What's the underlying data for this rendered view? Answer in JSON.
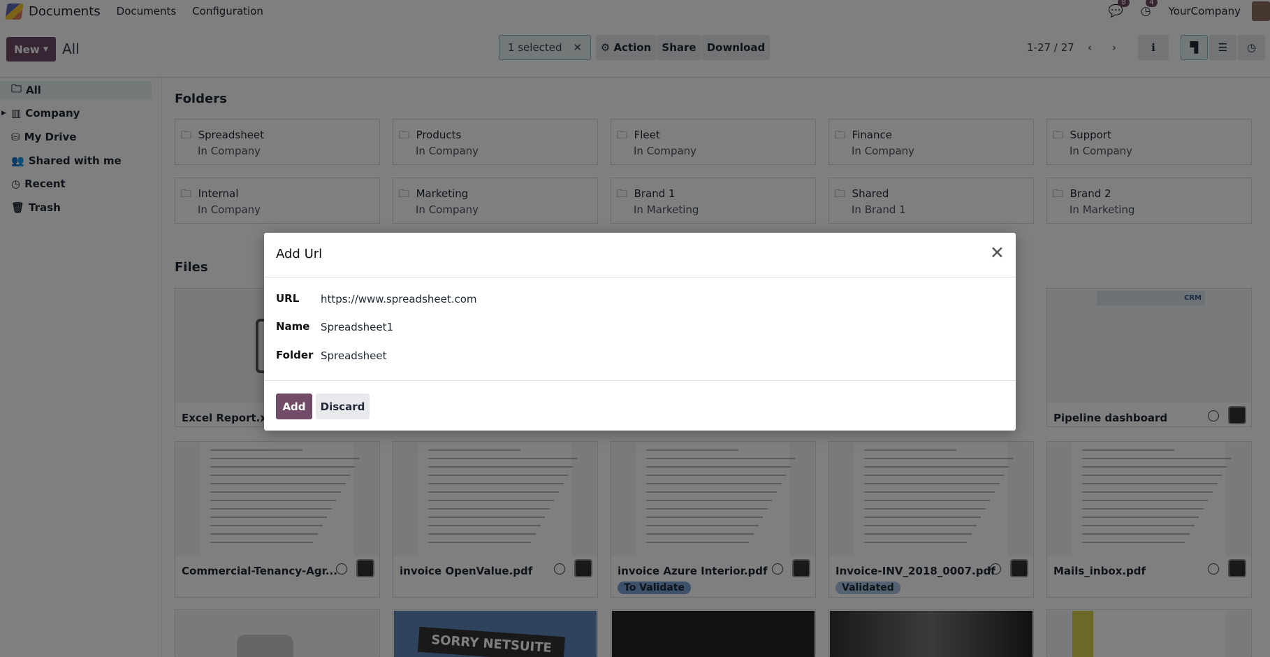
{
  "navbar": {
    "app": "Documents",
    "menus": [
      "Documents",
      "Configuration"
    ],
    "messages_count": "8",
    "activities_count": "4",
    "company": "YourCompany"
  },
  "control_panel": {
    "new_label": "New",
    "breadcrumb": "All",
    "selected": "1 selected",
    "action": "Action",
    "share": "Share",
    "download": "Download",
    "pager": "1-27 / 27"
  },
  "sidebar": {
    "items": [
      {
        "label": "All",
        "icon": "folder-icon"
      },
      {
        "label": "Company",
        "icon": "building-icon"
      },
      {
        "label": "My Drive",
        "icon": "drive-icon"
      },
      {
        "label": "Shared with me",
        "icon": "users-icon"
      },
      {
        "label": "Recent",
        "icon": "clock-icon"
      },
      {
        "label": "Trash",
        "icon": "trash-icon"
      }
    ]
  },
  "folders_title": "Folders",
  "folders": [
    {
      "name": "Spreadsheet",
      "parent": "In Company"
    },
    {
      "name": "Products",
      "parent": "In Company"
    },
    {
      "name": "Fleet",
      "parent": "In Company"
    },
    {
      "name": "Finance",
      "parent": "In Company"
    },
    {
      "name": "Support",
      "parent": "In Company"
    },
    {
      "name": "Internal",
      "parent": "In Company"
    },
    {
      "name": "Marketing",
      "parent": "In Company"
    },
    {
      "name": "Brand 1",
      "parent": "In Marketing"
    },
    {
      "name": "Shared",
      "parent": "In Brand 1"
    },
    {
      "name": "Brand 2",
      "parent": "In Marketing"
    }
  ],
  "files_title": "Files",
  "files": [
    {
      "name": "Excel Report.xlsx"
    },
    {
      "name": "Pipeline dashboard",
      "thumb_text": "CRM"
    },
    {
      "name": "Commercial-Tenancy-Agr..."
    },
    {
      "name": "invoice OpenValue.pdf"
    },
    {
      "name": "invoice Azure Interior.pdf",
      "tag": "To Validate"
    },
    {
      "name": "Invoice-INV_2018_0007.pdf",
      "tag": "Validated"
    },
    {
      "name": "Mails_inbox.pdf"
    },
    {
      "thumb_text": "SORRY NETSUITE"
    }
  ],
  "modal": {
    "title": "Add Url",
    "fields": [
      {
        "label": "URL",
        "value": "https://www.spreadsheet.com"
      },
      {
        "label": "Name",
        "value": "Spreadsheet1"
      },
      {
        "label": "Folder",
        "value": "Spreadsheet"
      }
    ],
    "add": "Add",
    "discard": "Discard"
  },
  "colors": {
    "primary": "#714B67",
    "selection": "#e6f2f3"
  }
}
